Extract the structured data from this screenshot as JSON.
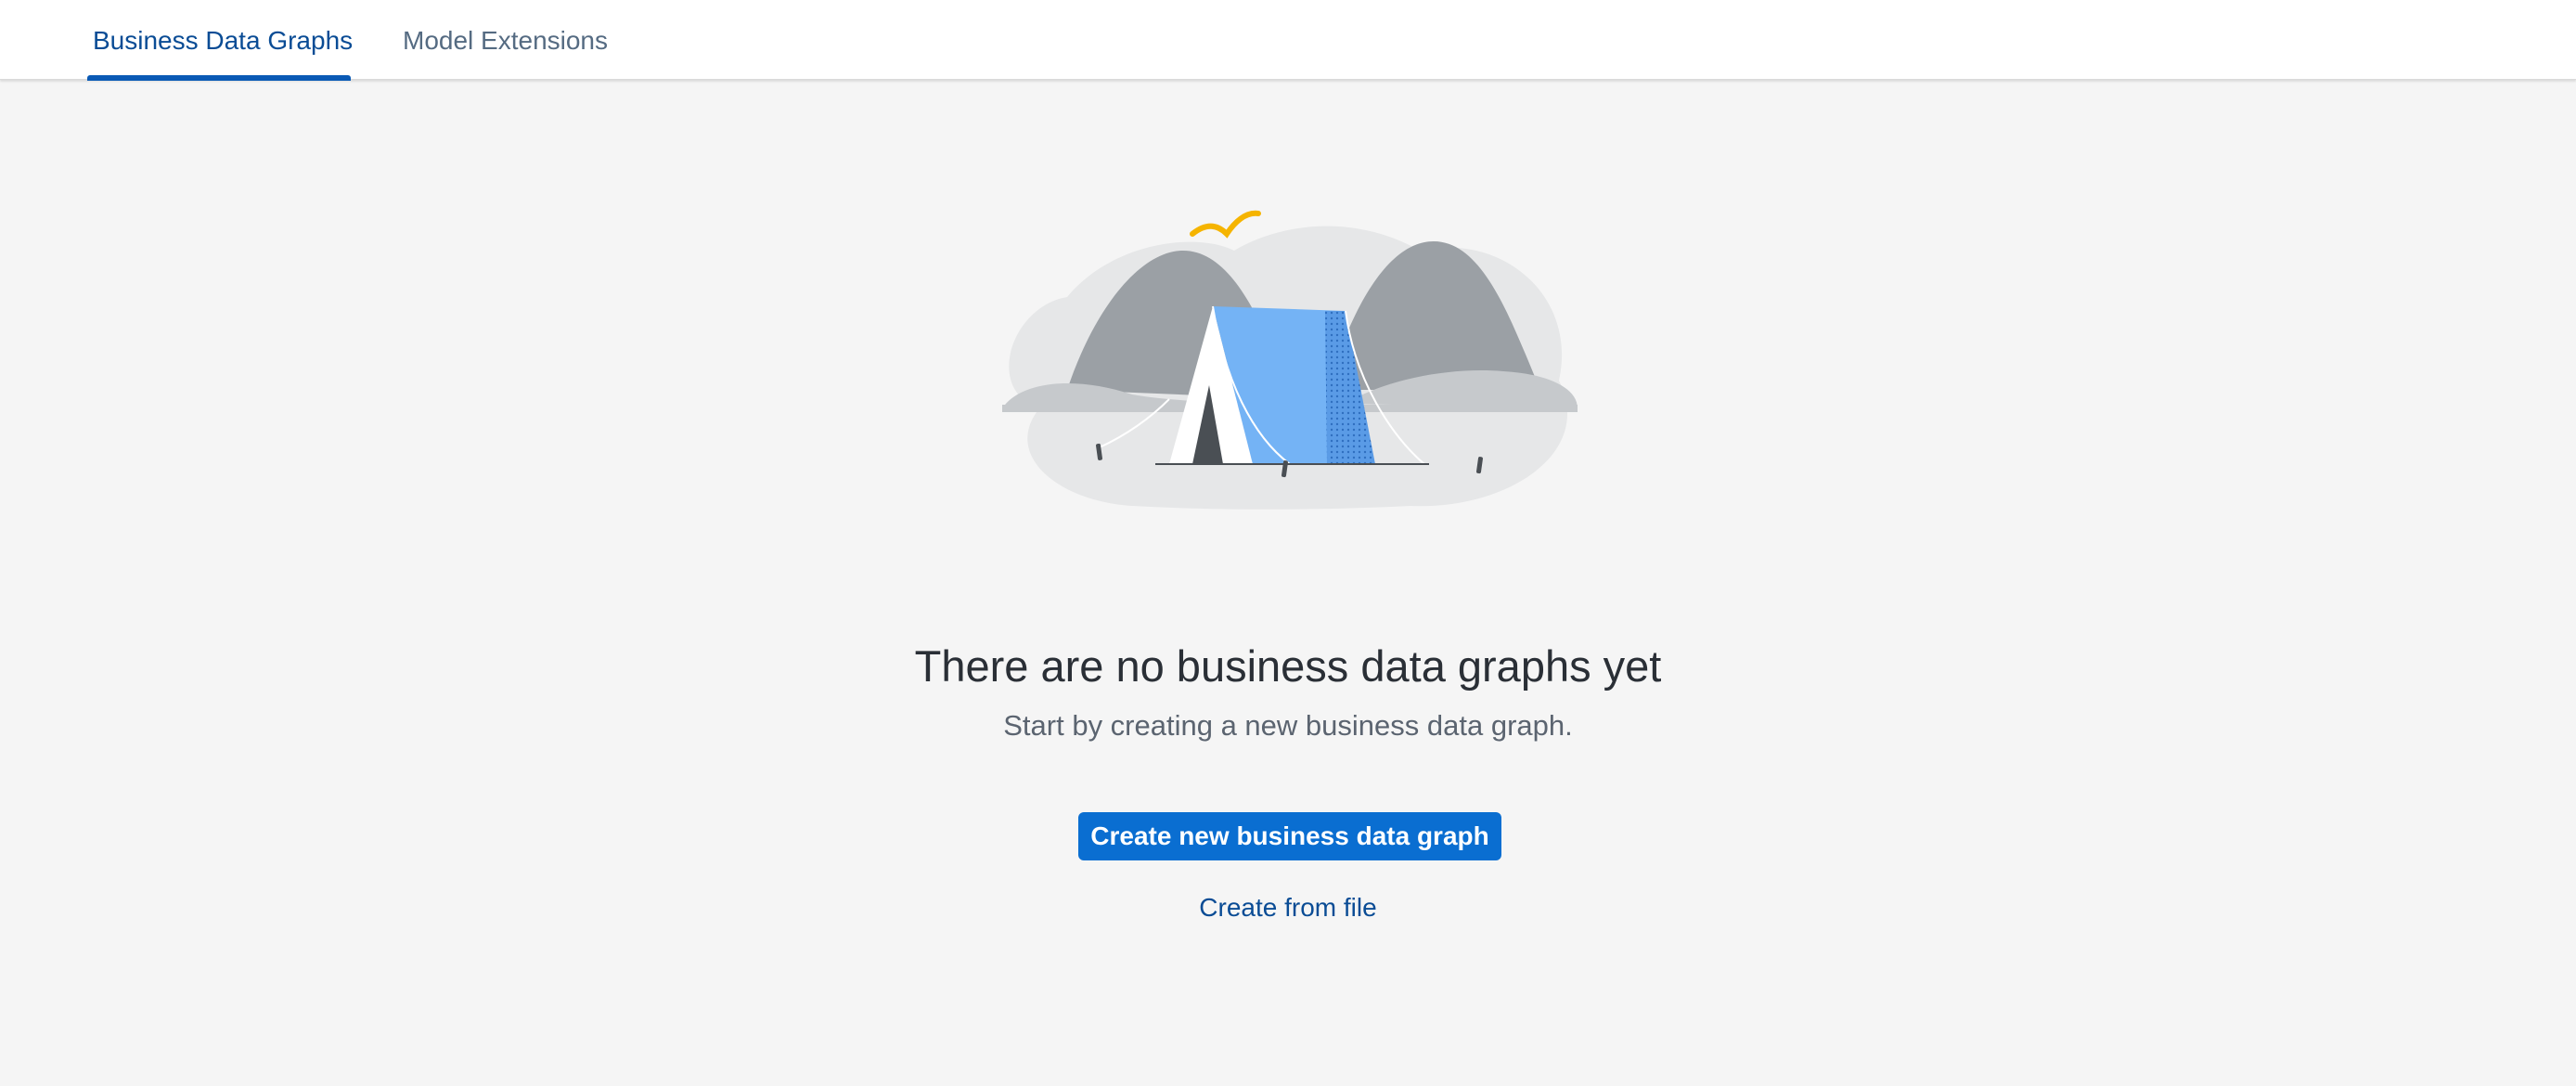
{
  "tabs": [
    {
      "label": "Business Data Graphs",
      "active": true
    },
    {
      "label": "Model Extensions",
      "active": false
    }
  ],
  "empty_state": {
    "illustration": "tent-camping-illustration",
    "title": "There are no business data graphs yet",
    "subtitle": "Start by creating a new business data graph.",
    "primary_action": "Create new business data graph",
    "secondary_action": "Create from file"
  },
  "colors": {
    "accent": "#0a6ed1",
    "active_tab_text": "#0a4c95",
    "background": "#f5f5f5",
    "tent_blue": "#74b3f5",
    "bird_yellow": "#f5b400",
    "mountain_gray": "#9aa0a6"
  }
}
